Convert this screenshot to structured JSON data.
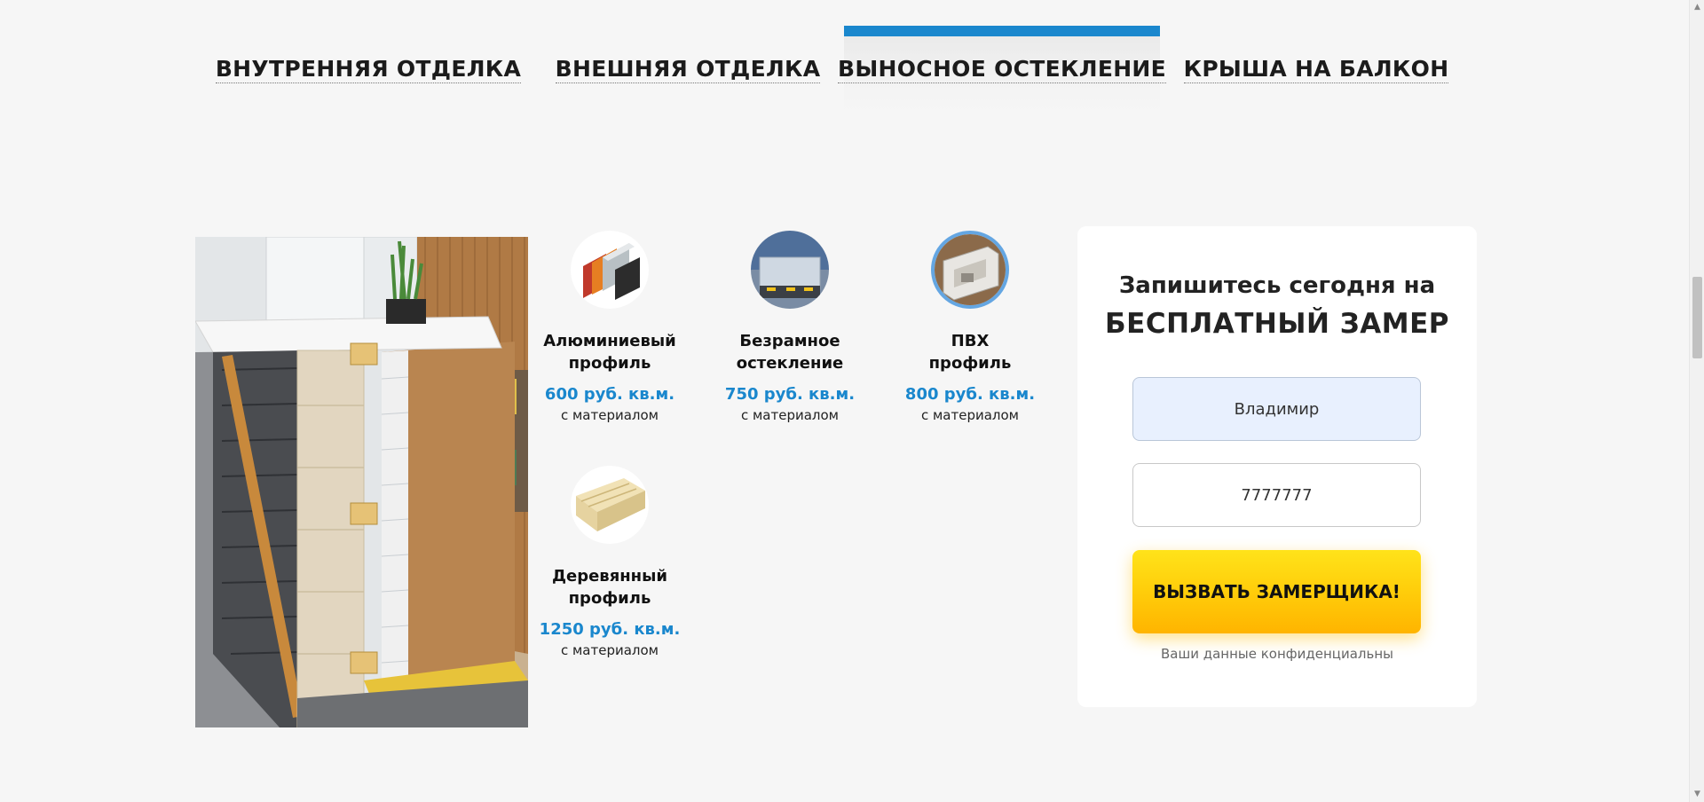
{
  "tabs": [
    {
      "label": "ВНУТРЕННЯЯ ОТДЕЛКА",
      "active": false
    },
    {
      "label": "ВНЕШНЯЯ ОТДЕЛКА",
      "active": false
    },
    {
      "label": "ВЫНОСНОЕ ОСТЕКЛЕНИЕ",
      "active": true
    },
    {
      "label": "КРЫША НА БАЛКОН",
      "active": false
    }
  ],
  "products": [
    {
      "name_line1": "Алюминиевый",
      "name_line2": "профиль",
      "price": "600 руб. кв.м.",
      "note": "с материалом",
      "icon": "aluminum-profile-icon"
    },
    {
      "name_line1": "Безрамное",
      "name_line2": "остекление",
      "price": "750 руб. кв.м.",
      "note": "с материалом",
      "icon": "frameless-glazing-icon"
    },
    {
      "name_line1": "ПВХ",
      "name_line2": "профиль",
      "price": "800 руб. кв.м.",
      "note": "с материалом",
      "icon": "pvc-profile-icon"
    },
    {
      "name_line1": "Деревянный",
      "name_line2": "профиль",
      "price": "1250 руб. кв.м.",
      "note": "с материалом",
      "icon": "wooden-profile-icon"
    }
  ],
  "form": {
    "title_line1": "Запишитесь сегодня на",
    "title_line2": "БЕСПЛАТНЫЙ ЗАМЕР",
    "name_value": "Владимир",
    "phone_value": "7777777",
    "submit_label": "ВЫЗВАТЬ ЗАМЕРЩИКА!",
    "privacy_note": "Ваши данные конфиденциальны"
  },
  "colors": {
    "accent": "#1a87cd",
    "button": "#ffc600",
    "background": "#f6f6f6"
  }
}
